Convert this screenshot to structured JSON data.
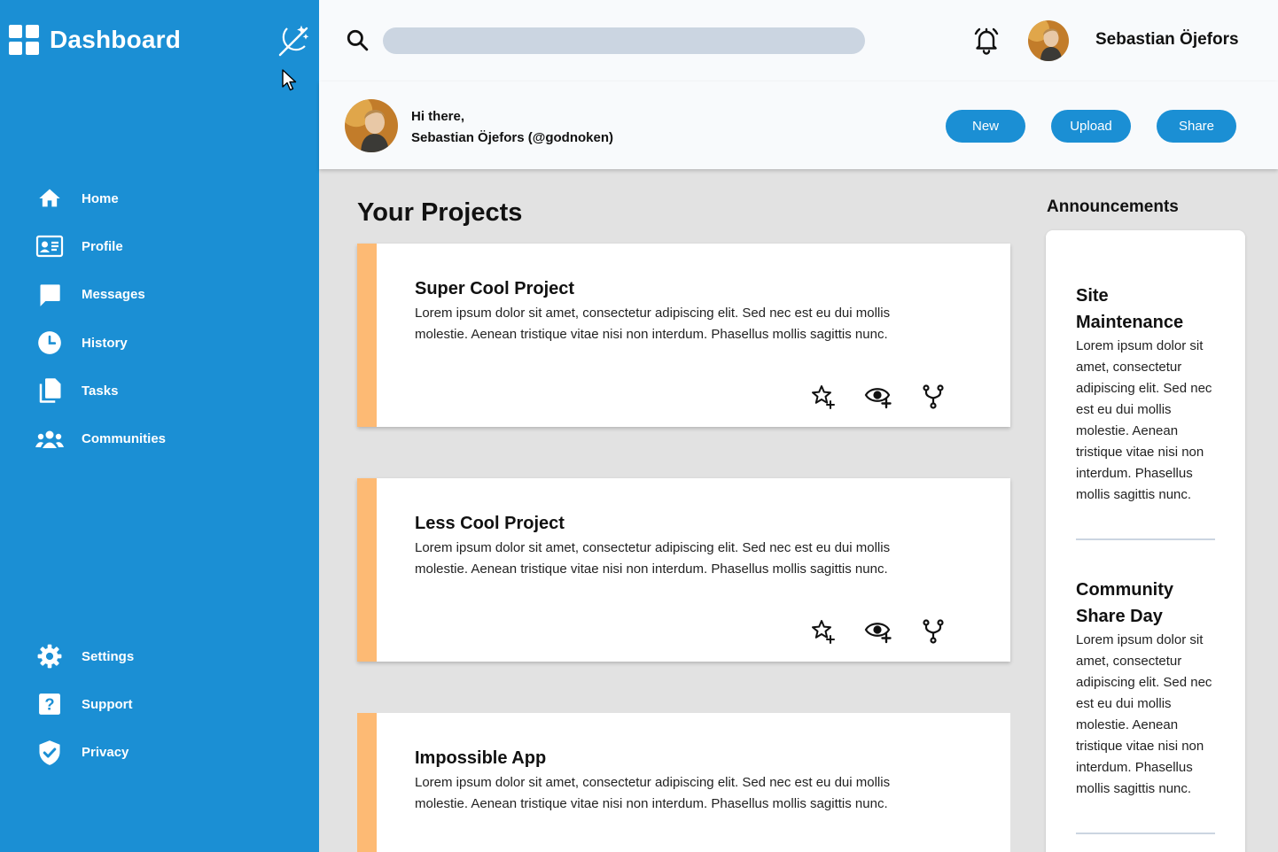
{
  "colors": {
    "sidebar_bg": "#1b8fd4",
    "accent": "#1b8fd4",
    "card_accent": "#fdba74",
    "topbar_bg": "#f8fafc",
    "main_bg": "#e2e2e2",
    "search_bg": "#cbd5e1"
  },
  "sidebar": {
    "brand_title": "Dashboard",
    "brand_icon": "grid-icon",
    "theme_toggle_icon": "theme-toggle-icon",
    "nav_top": [
      {
        "label": "Home",
        "icon": "home-icon"
      },
      {
        "label": "Profile",
        "icon": "id-card-icon"
      },
      {
        "label": "Messages",
        "icon": "message-icon"
      },
      {
        "label": "History",
        "icon": "clock-icon"
      },
      {
        "label": "Tasks",
        "icon": "documents-icon"
      },
      {
        "label": "Communities",
        "icon": "group-icon"
      }
    ],
    "nav_bottom": [
      {
        "label": "Settings",
        "icon": "gear-icon"
      },
      {
        "label": "Support",
        "icon": "help-icon"
      },
      {
        "label": "Privacy",
        "icon": "shield-icon"
      }
    ]
  },
  "header": {
    "search_placeholder": "",
    "search_value": "",
    "username": "Sebastian Öjefors"
  },
  "greeting": {
    "line1": "Hi there,",
    "line2": "Sebastian Öjefors (@godnoken)",
    "buttons": {
      "new": "New",
      "upload": "Upload",
      "share": "Share"
    }
  },
  "projects": {
    "title": "Your Projects",
    "items": [
      {
        "title": "Super Cool Project",
        "description": "Lorem ipsum dolor sit amet, consectetur adipiscing elit. Sed nec est eu dui mollis molestie. Aenean tristique vitae nisi non interdum. Phasellus mollis sagittis nunc."
      },
      {
        "title": "Less Cool Project",
        "description": "Lorem ipsum dolor sit amet, consectetur adipiscing elit. Sed nec est eu dui mollis molestie. Aenean tristique vitae nisi non interdum. Phasellus mollis sagittis nunc."
      },
      {
        "title": "Impossible App",
        "description": "Lorem ipsum dolor sit amet, consectetur adipiscing elit. Sed nec est eu dui mollis molestie. Aenean tristique vitae nisi non interdum. Phasellus mollis sagittis nunc."
      }
    ],
    "action_icons": [
      "star-plus-icon",
      "eye-plus-icon",
      "fork-icon"
    ]
  },
  "announcements": {
    "title": "Announcements",
    "items": [
      {
        "title": "Site Maintenance",
        "body": "Lorem ipsum dolor sit amet, consectetur adipiscing elit. Sed nec est eu dui mollis molestie. Aenean tristique vitae nisi non interdum. Phasellus mollis sagittis nunc."
      },
      {
        "title": "Community Share Day",
        "body": "Lorem ipsum dolor sit amet, consectetur adipiscing elit. Sed nec est eu dui mollis molestie. Aenean tristique vitae nisi non interdum. Phasellus mollis sagittis nunc."
      }
    ]
  }
}
